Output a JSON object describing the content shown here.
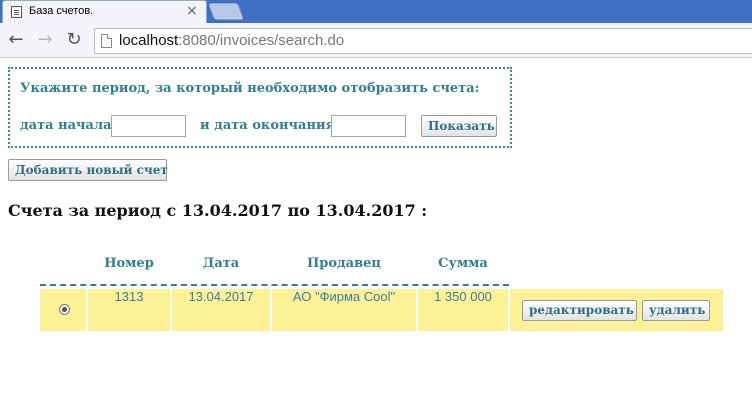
{
  "browser": {
    "tab_title": "База счетов.",
    "tab_close": "×",
    "url_host": "localhost",
    "url_rest": ":8080/invoices/search.do",
    "back": "←",
    "forward": "→",
    "reload": "↻"
  },
  "filter": {
    "prompt": "Укажите период, за который необходимо отобразить счета:",
    "start_label": "дата начала",
    "start_value": "",
    "end_label": "и дата окончания",
    "end_value": "",
    "show_button": "Показать"
  },
  "add_button": "Добавить новый счет",
  "period_heading": "Счета за период с 13.04.2017 по 13.04.2017 :",
  "table": {
    "columns": [
      "Номер",
      "Дата",
      "Продавец",
      "Сумма"
    ],
    "rows": [
      {
        "number": "1313",
        "date": "13.04.2017",
        "seller": "АО \"Фирма Cool\"",
        "amount": "1 350 000",
        "edit_label": "редактировать",
        "delete_label": "удалить"
      }
    ]
  },
  "colors": {
    "accent_text": "#2f7f91",
    "row_highlight": "#fdf198",
    "tab_strip": "#3f6fc4"
  }
}
